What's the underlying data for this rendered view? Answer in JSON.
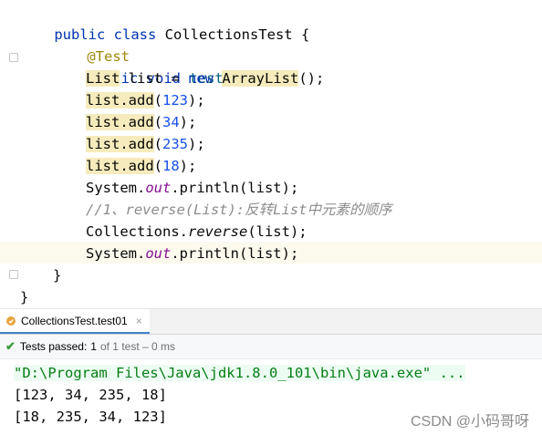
{
  "editor": {
    "class_decl": {
      "kw": "public class",
      "name": "CollectionsTest",
      "brace": "{"
    },
    "annotation": "@Test",
    "method_decl": {
      "kw": "public void",
      "name": "test01",
      "paren": "(){"
    },
    "list_decl": {
      "type": "List",
      "rest1": " list = ",
      "kw_new": "new",
      "sp": " ",
      "cls": "ArrayList",
      "rest2": "();"
    },
    "adds": [
      {
        "prefix": "list.add",
        "open": "(",
        "num": "123",
        "close": ");"
      },
      {
        "prefix": "list.add",
        "open": "(",
        "num": "34",
        "close": ");"
      },
      {
        "prefix": "list.add",
        "open": "(",
        "num": "235",
        "close": ");"
      },
      {
        "prefix": "list.add",
        "open": "(",
        "num": "18",
        "close": ");"
      }
    ],
    "println1": {
      "a": "System.",
      "out": "out",
      "b": ".println(list);"
    },
    "comment": "//1、reverse(List):反转List中元素的顺序",
    "reverse_call": {
      "a": "Collections.",
      "method": "reverse",
      "b": "(list);"
    },
    "println2": {
      "a": "System.",
      "out": "out",
      "b": ".println(list);"
    },
    "close_method": "}",
    "close_class": "}"
  },
  "run_tab": {
    "label": "CollectionsTest.test01",
    "close_icon": "×"
  },
  "status": {
    "check": "✔",
    "label": "Tests passed:",
    "count": "1",
    "total": "of 1 test – 0 ms"
  },
  "console": {
    "command": "\"D:\\Program Files\\Java\\jdk1.8.0_101\\bin\\java.exe\" ...",
    "lines": [
      "[123, 34, 235, 18]",
      "[18, 235, 34, 123]"
    ]
  },
  "watermark": "CSDN @小码哥呀",
  "colors": {
    "keyword": "#0033b3",
    "annotation": "#9e880d",
    "number": "#1750eb",
    "static_field": "#871094",
    "comment": "#8c8c8c",
    "pass": "#3c9b3c"
  }
}
